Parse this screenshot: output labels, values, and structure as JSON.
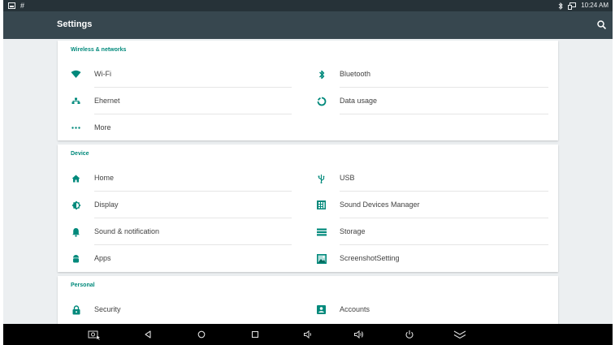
{
  "status_bar": {
    "left_icons": [
      "notification-image-icon"
    ],
    "hash": "#",
    "right_icons": [
      "bluetooth-icon",
      "cast-icon"
    ],
    "time": "10:24 AM"
  },
  "app_bar": {
    "title": "Settings",
    "search_icon": "search-icon"
  },
  "sections": [
    {
      "header": "Wireless & networks",
      "items": [
        {
          "label": "Wi-Fi",
          "icon": "wifi-icon"
        },
        {
          "label": "Bluetooth",
          "icon": "bluetooth-icon"
        },
        {
          "label": "Ehernet",
          "icon": "ethernet-icon"
        },
        {
          "label": "Data usage",
          "icon": "data-usage-icon"
        },
        {
          "label": "More",
          "icon": "more-icon"
        }
      ]
    },
    {
      "header": "Device",
      "items": [
        {
          "label": "Home",
          "icon": "home-icon"
        },
        {
          "label": "USB",
          "icon": "usb-icon"
        },
        {
          "label": "Display",
          "icon": "display-icon"
        },
        {
          "label": "Sound Devices Manager",
          "icon": "sound-devices-icon"
        },
        {
          "label": "Sound & notification",
          "icon": "bell-icon"
        },
        {
          "label": "Storage",
          "icon": "storage-icon"
        },
        {
          "label": "Apps",
          "icon": "apps-icon"
        },
        {
          "label": "ScreenshotSetting",
          "icon": "screenshot-setting-icon"
        }
      ]
    },
    {
      "header": "Personal",
      "items": [
        {
          "label": "Security",
          "icon": "lock-icon"
        },
        {
          "label": "Accounts",
          "icon": "account-icon"
        }
      ]
    }
  ],
  "nav_bar": {
    "buttons": [
      "screenshot-icon",
      "back-icon",
      "home-circle-icon",
      "recents-icon",
      "volume-down-icon",
      "volume-up-icon",
      "power-icon",
      "collapse-icon"
    ]
  },
  "colors": {
    "accent": "#00897b",
    "app_bar": "#37474f",
    "status_bar": "#263238",
    "background": "#eceff1"
  }
}
